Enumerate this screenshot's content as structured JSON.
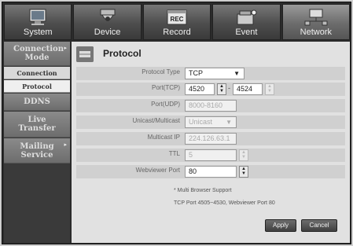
{
  "tabs": [
    {
      "label": "System",
      "icon": "system-monitor-icon"
    },
    {
      "label": "Device",
      "icon": "camera-icon"
    },
    {
      "label": "Record",
      "icon": "record-icon",
      "icon_text": "REC"
    },
    {
      "label": "Event",
      "icon": "event-alarm-icon"
    },
    {
      "label": "Network",
      "icon": "network-icon"
    }
  ],
  "sidebar": {
    "items": [
      {
        "label": "Connection Mode"
      },
      {
        "label": "Connection"
      },
      {
        "label": "Protocol"
      },
      {
        "label": "DDNS"
      },
      {
        "label": "Live Transfer"
      },
      {
        "label": "Mailing Service"
      }
    ]
  },
  "panel": {
    "title": "Protocol",
    "fields": {
      "protocol_type": {
        "label": "Protocol Type",
        "value": "TCP"
      },
      "port_tcp": {
        "label": "Port(TCP)",
        "from": "4520",
        "to": "4524"
      },
      "port_udp": {
        "label": "Port(UDP)",
        "value": "8000-8160"
      },
      "unicast": {
        "label": "Unicast/Multicast",
        "value": "Unicast"
      },
      "multicast_ip": {
        "label": "Multicast IP",
        "value": "224.126.63.1"
      },
      "ttl": {
        "label": "TTL",
        "value": "5"
      },
      "webviewer_port": {
        "label": "Webviewer Port",
        "value": "80"
      }
    },
    "notes": [
      "* Multi Browser Support",
      "TCP Port 4505~4530, Webviewer Port 80"
    ],
    "apply_label": "Apply",
    "cancel_label": "Cancel"
  }
}
